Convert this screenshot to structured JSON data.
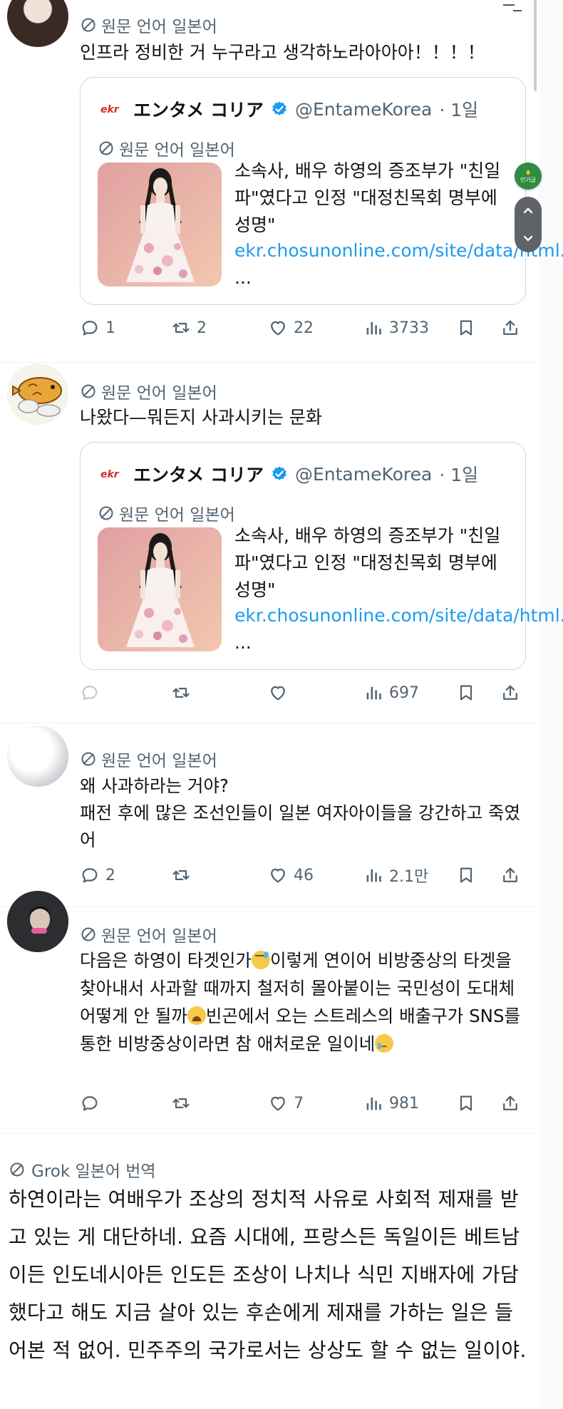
{
  "translation_label": "원문 언어 일본어",
  "quoted_source": {
    "name": "エンタメ コリア",
    "handle": "@EntameKorea",
    "time": "· 1일",
    "title": "소속사, 배우 하영의 증조부가 \"친일파\"였다고 인정 \"대정친목회 명부에 성명\"",
    "link": "ekr.chosunonline.com/site/data/html...",
    "dots": " ..."
  },
  "posts": [
    {
      "text": "인프라 정비한 거 누구라고 생각하노라아아아！！！！",
      "stats": {
        "replies": "1",
        "reposts": "2",
        "likes": "22",
        "views": "3733"
      }
    },
    {
      "text": "나왔다—뭐든지 사과시키는 문화",
      "stats": {
        "replies": "",
        "reposts": "",
        "likes": "",
        "views": "697"
      }
    },
    {
      "text": "왜 사과하라는 거야?\n패전 후에 많은 조선인들이 일본 여자아이들을 강간하고 죽였어",
      "stats": {
        "replies": "2",
        "reposts": "",
        "likes": "46",
        "views": "2.1만"
      }
    },
    {
      "text_parts": [
        "다음은 하영이 타겟인가",
        "이렇게 연이어 비방중상의 타겟을 찾아내서 사과할 때까지 철저히 몰아붙이는 국민성이 도대체 어떻게 안 될까",
        "빈곤에서 오는 스트레스의 배출구가 SNS를 통한 비방중상이라면 참 애처로운 일이네"
      ],
      "stats": {
        "replies": "",
        "reposts": "",
        "likes": "7",
        "views": "981"
      }
    }
  ],
  "floating": {
    "popular_label": "인기글"
  },
  "grok": {
    "label": "Grok 일본어 번역",
    "text": "하연이라는 여배우가 조상의 정치적 사유로 사회적 제재를 받고 있는 게 대단하네. 요즘 시대에, 프랑스든 독일이든 베트남이든 인도네시아든 인도든 조상이 나치나 식민 지배자에 가담했다고 해도 지금 살아 있는 후손에게 제재를 가하는 일은 들어본 적 없어. 민주주의 국가로서는 상상도 할 수 없는 일이야."
  },
  "colors": {
    "link": "#1d9bf0",
    "secondary": "#536471",
    "border": "#cfd9de",
    "verified": "#1d9bf0"
  },
  "icons": [
    "translate-icon",
    "reply-icon",
    "repost-icon",
    "like-icon",
    "views-icon",
    "bookmark-icon",
    "share-icon",
    "verified-badge-icon",
    "chevron-up-icon",
    "chevron-down-icon"
  ]
}
